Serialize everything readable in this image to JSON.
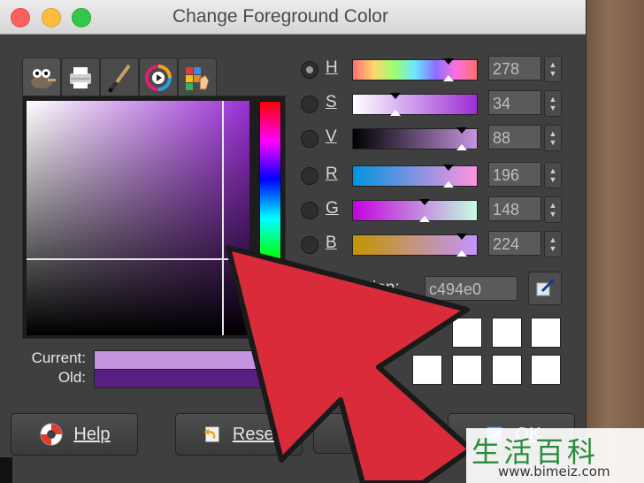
{
  "window": {
    "title": "Change Foreground Color"
  },
  "tabs": [
    {
      "icon": "gimp-wilber-icon"
    },
    {
      "icon": "printer-icon"
    },
    {
      "icon": "paintbrush-icon"
    },
    {
      "icon": "color-wheel-icon"
    },
    {
      "icon": "palette-icon"
    }
  ],
  "swatches": {
    "current_label": "Current:",
    "old_label": "Old:",
    "current_color": "#c494e0",
    "old_color": "#5a1d80"
  },
  "channels": [
    {
      "letter": "H",
      "value": "278",
      "selected": true
    },
    {
      "letter": "S",
      "value": "34",
      "selected": false
    },
    {
      "letter": "V",
      "value": "88",
      "selected": false
    },
    {
      "letter": "R",
      "value": "196",
      "selected": false
    },
    {
      "letter": "G",
      "value": "148",
      "selected": false
    },
    {
      "letter": "B",
      "value": "224",
      "selected": false
    }
  ],
  "notation": {
    "label": "tation:",
    "value": "c494e0"
  },
  "buttons": {
    "help": "Help",
    "reset": "Reset",
    "cancel": "Cance",
    "ok": "OK"
  },
  "watermark": {
    "chars": "生活百科",
    "url": "www.bimeiz.com"
  },
  "colors": {
    "arrow": "#d92b3a",
    "dialog_bg": "#3f3f3f"
  }
}
